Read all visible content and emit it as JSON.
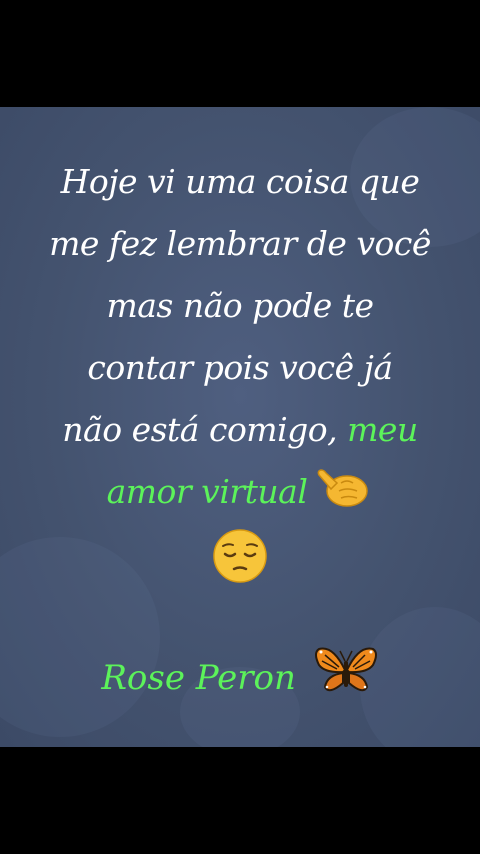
{
  "quote": {
    "line1": "Hoje vi uma coisa que",
    "line2": "me fez lembrar de você",
    "line3": "mas não pode te",
    "line4": "contar pois você já",
    "line5_white": "não está comigo,",
    "line5_green": "meu",
    "line6_green": "amor virtual"
  },
  "signature": {
    "name": "Rose Peron"
  },
  "colors": {
    "background": "#46556f",
    "text": "#ffffff",
    "accent_green": "#5cf35a",
    "outer": "#000000"
  },
  "icons": {
    "pointing": "pointing-finger-icon",
    "face": "pensive-face-icon",
    "butterfly": "butterfly-icon"
  }
}
